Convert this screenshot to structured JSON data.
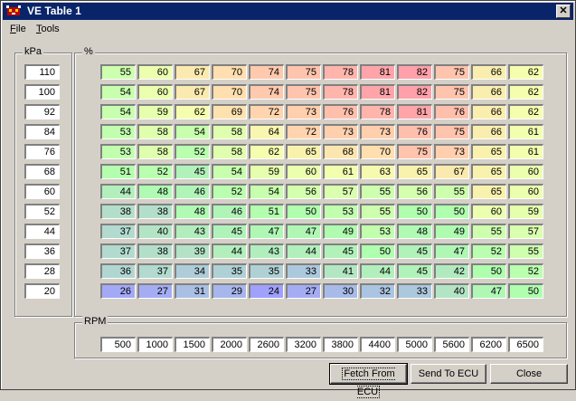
{
  "window": {
    "title": "VE Table 1",
    "close_glyph": "✕"
  },
  "menu": {
    "file_accel": "F",
    "file_rest": "ile",
    "tools_accel": "T",
    "tools_rest": "ools"
  },
  "kpa_group": {
    "label": "kPa",
    "values": [
      "110",
      "100",
      "92",
      "84",
      "76",
      "68",
      "60",
      "52",
      "44",
      "36",
      "28",
      "20"
    ]
  },
  "ve_group": {
    "label": "%"
  },
  "table": [
    [
      "55",
      "60",
      "67",
      "70",
      "74",
      "75",
      "78",
      "81",
      "82",
      "75",
      "66",
      "62"
    ],
    [
      "54",
      "60",
      "67",
      "70",
      "74",
      "75",
      "78",
      "81",
      "82",
      "75",
      "66",
      "62"
    ],
    [
      "54",
      "59",
      "62",
      "69",
      "72",
      "73",
      "76",
      "78",
      "81",
      "76",
      "66",
      "62"
    ],
    [
      "53",
      "58",
      "54",
      "58",
      "64",
      "72",
      "73",
      "73",
      "76",
      "75",
      "66",
      "61"
    ],
    [
      "53",
      "58",
      "52",
      "58",
      "62",
      "65",
      "68",
      "70",
      "75",
      "73",
      "65",
      "61"
    ],
    [
      "51",
      "52",
      "45",
      "54",
      "59",
      "60",
      "61",
      "63",
      "65",
      "67",
      "65",
      "60"
    ],
    [
      "44",
      "48",
      "46",
      "52",
      "54",
      "56",
      "57",
      "55",
      "56",
      "55",
      "65",
      "60"
    ],
    [
      "38",
      "38",
      "48",
      "46",
      "51",
      "50",
      "53",
      "55",
      "50",
      "50",
      "60",
      "59"
    ],
    [
      "37",
      "40",
      "43",
      "45",
      "47",
      "47",
      "49",
      "53",
      "48",
      "49",
      "55",
      "57"
    ],
    [
      "37",
      "38",
      "39",
      "44",
      "43",
      "44",
      "45",
      "50",
      "45",
      "47",
      "52",
      "55"
    ],
    [
      "36",
      "37",
      "34",
      "35",
      "35",
      "33",
      "41",
      "44",
      "45",
      "42",
      "50",
      "52"
    ],
    [
      "26",
      "27",
      "31",
      "29",
      "24",
      "27",
      "30",
      "32",
      "33",
      "40",
      "47",
      "50"
    ]
  ],
  "rpm_group": {
    "label": "RPM",
    "values": [
      "500",
      "1000",
      "1500",
      "2000",
      "2600",
      "3200",
      "3800",
      "4400",
      "5000",
      "5600",
      "6200",
      "6500"
    ]
  },
  "buttons": {
    "fetch_label": "Fetch From ECU",
    "send_label": "Send To ECU",
    "close_label": "Close"
  },
  "colors": {
    "titlebar": "#0a246a",
    "face": "#d4d0c8"
  }
}
